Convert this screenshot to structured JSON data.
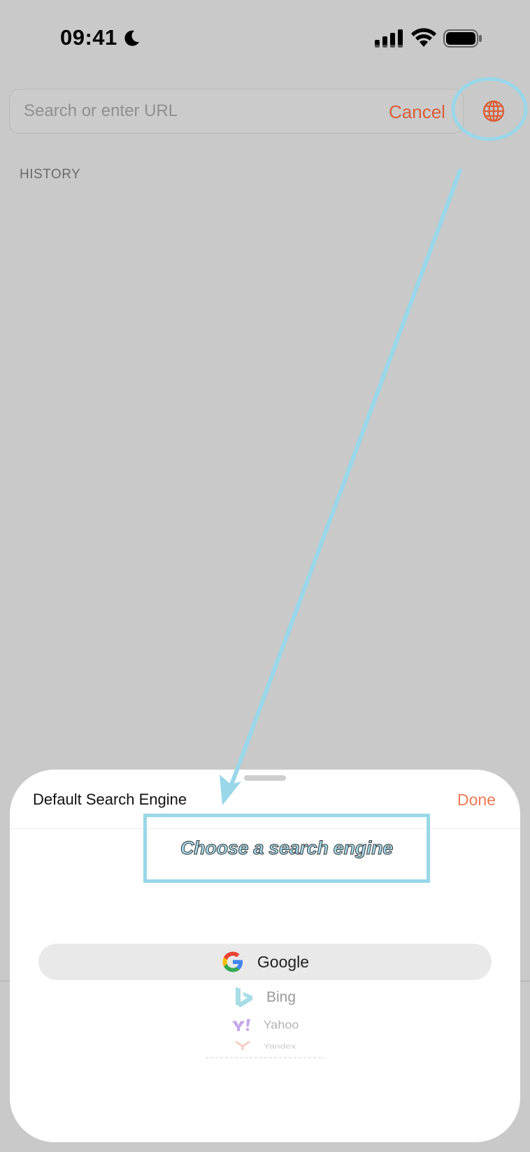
{
  "status_bar": {
    "time": "09:41",
    "icons": [
      "moon-icon",
      "cellular-signal-icon",
      "wifi-icon",
      "battery-icon"
    ]
  },
  "search": {
    "placeholder": "Search or enter URL",
    "cancel_label": "Cancel",
    "globe_icon": "globe-icon"
  },
  "history": {
    "header": "HISTORY"
  },
  "sheet": {
    "title": "Default Search Engine",
    "done_label": "Done",
    "callout": "Choose a search engine",
    "engines": [
      {
        "name": "Google",
        "icon": "google-logo-icon",
        "selected": true
      },
      {
        "name": "Bing",
        "icon": "bing-logo-icon",
        "selected": false
      },
      {
        "name": "Yahoo",
        "icon": "yahoo-logo-icon",
        "selected": false
      },
      {
        "name": "Yandex",
        "icon": "yandex-logo-icon",
        "selected": false
      }
    ]
  },
  "colors": {
    "accent": "#d95f3a",
    "done": "#ee7a55",
    "annotation": "#99d7e9",
    "dim_background": "#c9c9c9"
  }
}
